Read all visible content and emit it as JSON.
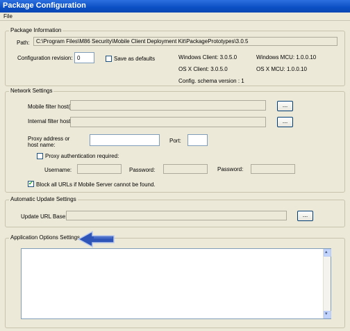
{
  "window": {
    "title": "Package Configuration"
  },
  "menu": {
    "file": "File"
  },
  "package_info": {
    "legend": "Package Information",
    "path_label": "Path:",
    "path_value": "C:\\Program Files\\M86 Security\\Mobile Client Deployment Kit\\PackagePrototypes\\3.0.5",
    "config_rev_label": "Configuration revision:",
    "config_rev_value": "0",
    "save_defaults_label": "Save as defaults",
    "windows_client": "Windows Client: 3.0.5.0",
    "windows_mcu": "Windows MCU: 1.0.0.10",
    "osx_client": "OS X Client: 3.0.5.0",
    "osx_mcu": "OS X MCU: 1.0.0.10",
    "schema_version": "Config. schema version : 1"
  },
  "network": {
    "legend": "Network Settings",
    "mobile_filter_label": "Mobile filter host(s):",
    "internal_filter_label": "Internal filter host(s):",
    "browse_label": "...",
    "proxy_address_label_1": "Proxy address or",
    "proxy_address_label_2": "host name:",
    "port_label": "Port:",
    "proxy_auth_label": "Proxy authentication required:",
    "username_label": "Username:",
    "password_label": "Password:",
    "password2_label": "Password:",
    "block_urls_label": "Block all URLs if Mobile Server cannot be found."
  },
  "auto_update": {
    "legend": "Automatic Update Settings",
    "url_label": "Update URL Base:",
    "browse_label": "..."
  },
  "app_options": {
    "legend": "Application Options Settings"
  },
  "colors": {
    "titlebar": "#0b4fc4",
    "arrow": "#2f55b8"
  }
}
